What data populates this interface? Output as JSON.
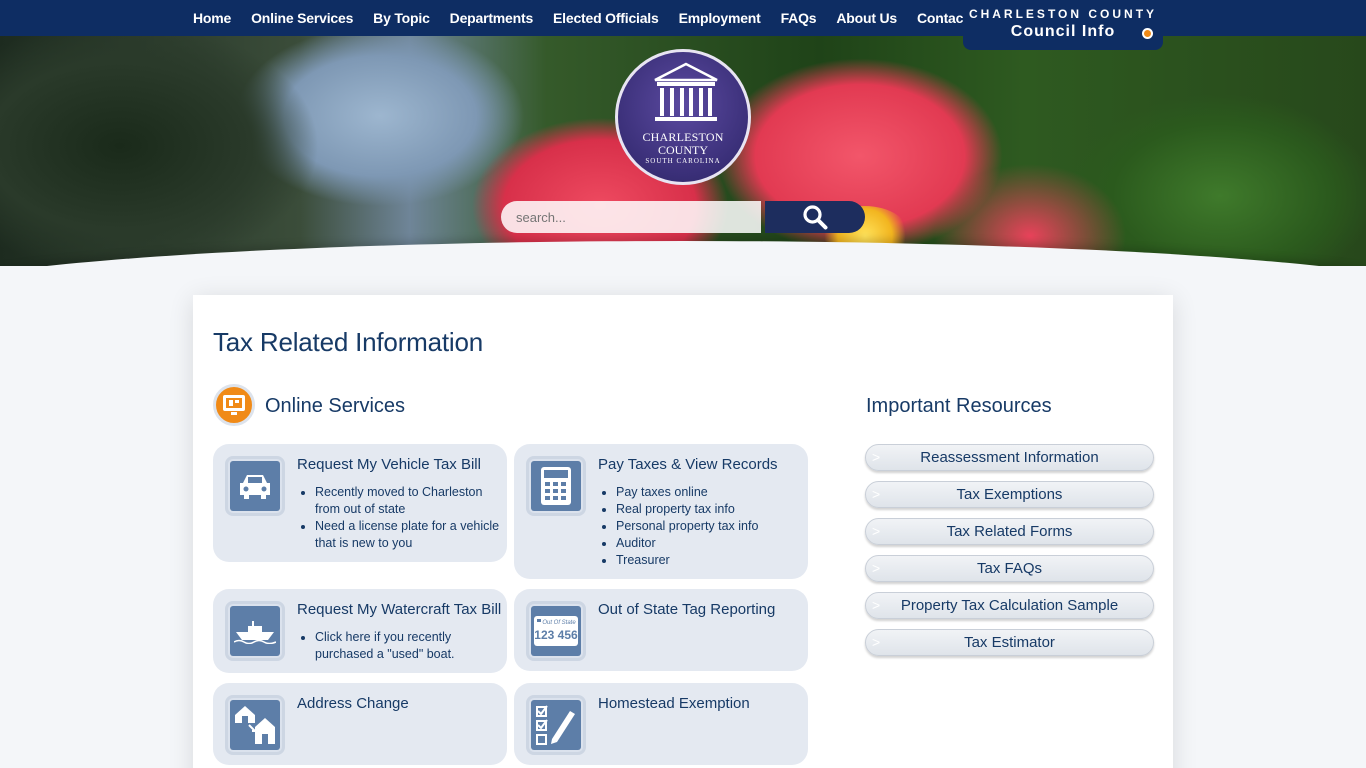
{
  "nav": {
    "items": [
      "Home",
      "Online Services",
      "By Topic",
      "Departments",
      "Elected Officials",
      "Employment",
      "FAQs",
      "About Us",
      "Contact"
    ]
  },
  "council": {
    "line1": "CHARLESTON COUNTY",
    "line2": "Council Info"
  },
  "seal": {
    "name1": "CHARLESTON",
    "name2": "COUNTY",
    "name3": "SOUTH CAROLINA"
  },
  "search": {
    "placeholder": "search..."
  },
  "page": {
    "title": "Tax Related Information"
  },
  "online_services": {
    "title": "Online Services",
    "tiles": [
      {
        "title": "Request My Vehicle Tax Bill",
        "bullets": [
          "Recently moved to Charleston from out of state",
          "Need a license plate for a vehicle that is new to you"
        ],
        "icon": "car-icon"
      },
      {
        "title": "Pay Taxes & View Records",
        "bullets": [
          "Pay taxes online",
          "Real property tax info",
          "Personal property tax info",
          "Auditor",
          "Treasurer"
        ],
        "icon": "calculator-icon"
      },
      {
        "title": "Request My Watercraft Tax Bill",
        "bullets": [
          "Click here if you recently purchased a \"used\" boat."
        ],
        "icon": "boat-icon"
      },
      {
        "title": "Out of State Tag Reporting",
        "bullets": [],
        "icon": "license-plate-icon",
        "plate_top": "Out Of State",
        "plate_num": "123 456"
      },
      {
        "title": "Address Change",
        "bullets": [],
        "icon": "house-move-icon"
      },
      {
        "title": "Homestead Exemption",
        "bullets": [],
        "icon": "checklist-icon"
      }
    ]
  },
  "resources": {
    "title": "Important Resources",
    "items": [
      "Reassessment Information",
      "Tax Exemptions",
      "Tax Related Forms",
      "Tax FAQs",
      "Property Tax Calculation Sample",
      "Tax Estimator"
    ]
  },
  "colors": {
    "nav_bg": "#0e2d63",
    "accent": "#f08a17",
    "tile_bg": "#e4e9f1",
    "icon_bg": "#5d7ea8",
    "text": "#173a66"
  }
}
